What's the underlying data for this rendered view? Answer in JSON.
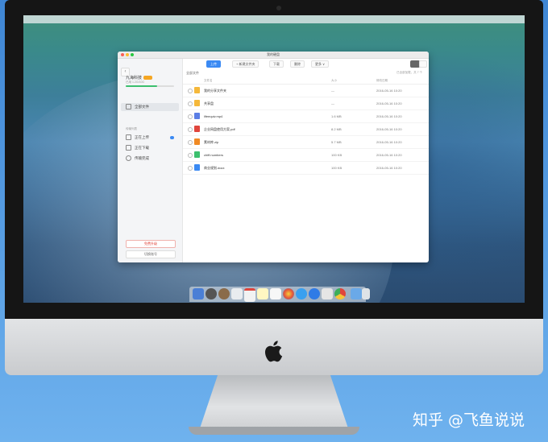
{
  "window": {
    "title": "我的硬盘",
    "back_label": "‹",
    "toolbar": {
      "upload": "上传",
      "new_folder": "+ 新建文件夹",
      "download": "下载",
      "delete": "删除",
      "more": "更多 ∨"
    }
  },
  "sidebar": {
    "username": "九海科技",
    "quota": "已用 1.2G/10G",
    "usage_percent": 65,
    "items": [
      {
        "label": "全部文件"
      },
      {
        "label": "正在上传"
      },
      {
        "label": "正在下载"
      },
      {
        "label": "传输完成"
      }
    ],
    "section_label": "传输列表",
    "upgrade_label": "免费升级",
    "logout_label": "切换账号"
  },
  "main": {
    "breadcrumb": "全部文件",
    "show_all": "已全部加载，共 7 个",
    "columns": {
      "name": "文件名",
      "size": "大小",
      "date": "修改日期"
    },
    "files": [
      {
        "name": "我的分享文件夹",
        "size": "—",
        "date": "2016-05-16 10:20",
        "icon": "folder-icon",
        "color": "#f5b83a"
      },
      {
        "name": "共享盘",
        "size": "—",
        "date": "2016-05-16 10:20",
        "icon": "folder-icon",
        "color": "#f5b83a"
      },
      {
        "name": "lifeequiv.mp4",
        "size": "1.6 MB",
        "date": "2016-05-16 10:20",
        "icon": "video-icon",
        "color": "#5b7ee5"
      },
      {
        "name": "企业网盘使用方案.pdf",
        "size": "8.2 MB",
        "date": "2016-05-16 10:20",
        "icon": "pdf-icon",
        "color": "#e0453c"
      },
      {
        "name": "素材库.zip",
        "size": "5.7 MB",
        "date": "2016-05-16 10:20",
        "icon": "zip-icon",
        "color": "#f08a24"
      },
      {
        "name": "chiff.numbers",
        "size": "100 KB",
        "date": "2016-05-16 10:20",
        "icon": "sheet-icon",
        "color": "#3cbf6e"
      },
      {
        "name": "商业规划.docx",
        "size": "100 KB",
        "date": "2016-05-16 10:20",
        "icon": "doc-icon",
        "color": "#3b8af3"
      }
    ]
  },
  "watermark": "知乎 @飞鱼说说"
}
